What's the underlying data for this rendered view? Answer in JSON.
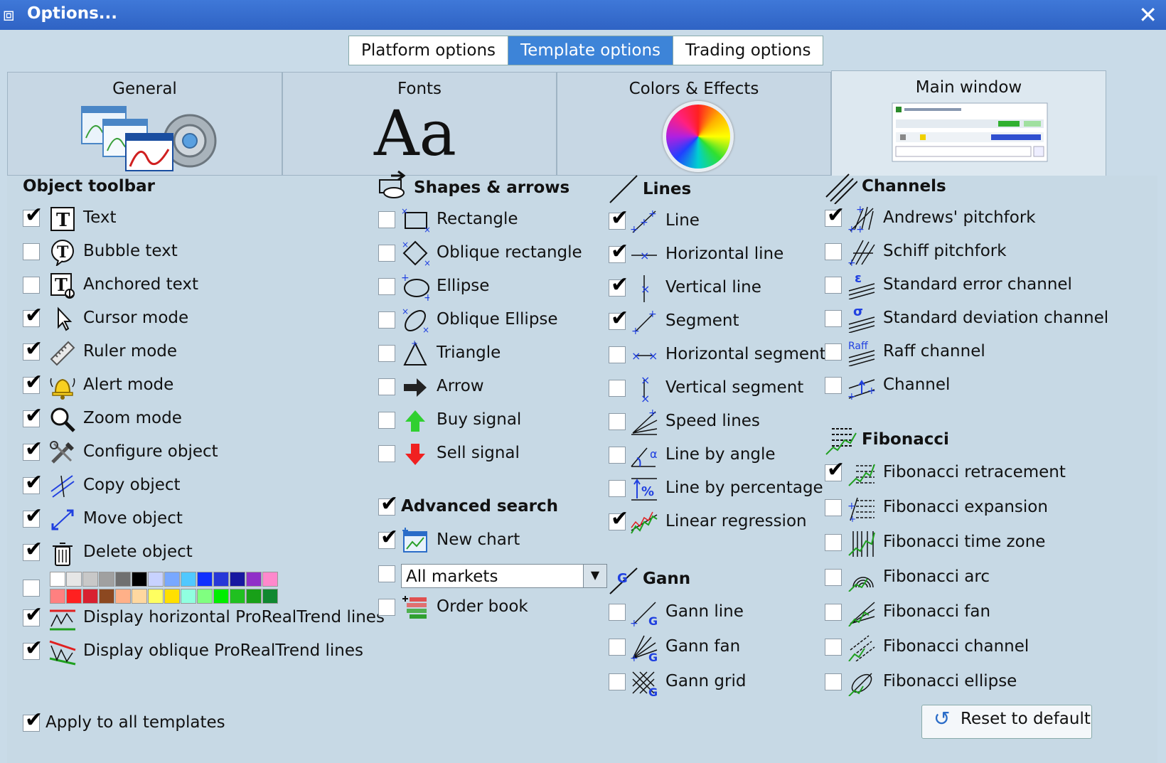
{
  "window": {
    "title": "Options..."
  },
  "top_tabs": [
    "Platform options",
    "Template options",
    "Trading options"
  ],
  "sub_tabs": [
    "General",
    "Fonts",
    "Colors & Effects",
    "Main window"
  ],
  "fonts_preview": "Aa",
  "object_toolbar": {
    "heading": "Object toolbar",
    "items": [
      {
        "label": "Text",
        "checked": true,
        "icon": "text-tool-icon"
      },
      {
        "label": "Bubble text",
        "checked": false,
        "icon": "bubble-text-icon"
      },
      {
        "label": "Anchored text",
        "checked": false,
        "icon": "anchored-text-icon"
      },
      {
        "label": "Cursor mode",
        "checked": true,
        "icon": "cursor-icon"
      },
      {
        "label": "Ruler mode",
        "checked": true,
        "icon": "ruler-icon"
      },
      {
        "label": "Alert mode",
        "checked": true,
        "icon": "bell-icon"
      },
      {
        "label": "Zoom mode",
        "checked": true,
        "icon": "magnifier-icon"
      },
      {
        "label": "Configure object",
        "checked": true,
        "icon": "tools-icon"
      },
      {
        "label": "Copy object",
        "checked": true,
        "icon": "copy-object-icon"
      },
      {
        "label": "Move object",
        "checked": true,
        "icon": "move-object-icon"
      },
      {
        "label": "Delete object",
        "checked": true,
        "icon": "trash-icon"
      }
    ],
    "palette_checked": false,
    "palette_row1": [
      "#ffffff",
      "#e6e6e6",
      "#c8c8c8",
      "#a0a0a0",
      "#707070",
      "#000000",
      "#c8d2ff",
      "#78a8ff",
      "#50c8ff",
      "#1030ff",
      "#2838d8",
      "#1818a0",
      "#9030c8",
      "#ff88cc"
    ],
    "palette_row2": [
      "#ff8080",
      "#ff2020",
      "#d82030",
      "#8c4820",
      "#ffb088",
      "#ffd8a0",
      "#ffff60",
      "#ffe000",
      "#90ffe0",
      "#80ff80",
      "#00ee00",
      "#20c020",
      "#18a018",
      "#108830"
    ],
    "extra_items": [
      {
        "label": "Display horizontal ProRealTrend lines",
        "checked": true,
        "icon": "prorealtrend-horizontal-icon"
      },
      {
        "label": "Display oblique ProRealTrend lines",
        "checked": true,
        "icon": "prorealtrend-oblique-icon"
      }
    ]
  },
  "shapes": {
    "heading": "Shapes & arrows",
    "items": [
      {
        "label": "Rectangle",
        "checked": false,
        "icon": "rectangle-icon"
      },
      {
        "label": "Oblique rectangle",
        "checked": false,
        "icon": "oblique-rectangle-icon"
      },
      {
        "label": "Ellipse",
        "checked": false,
        "icon": "ellipse-icon"
      },
      {
        "label": "Oblique Ellipse",
        "checked": false,
        "icon": "oblique-ellipse-icon"
      },
      {
        "label": "Triangle",
        "checked": false,
        "icon": "triangle-icon"
      },
      {
        "label": "Arrow",
        "checked": false,
        "icon": "arrow-icon"
      },
      {
        "label": "Buy signal",
        "checked": false,
        "icon": "buy-signal-icon"
      },
      {
        "label": "Sell signal",
        "checked": false,
        "icon": "sell-signal-icon"
      }
    ]
  },
  "advanced_search": {
    "heading": "Advanced search",
    "heading_checked": true,
    "new_chart": {
      "label": "New chart",
      "checked": true
    },
    "market_select": {
      "value": "All markets",
      "checked": false
    },
    "order_book": {
      "label": "Order book",
      "checked": false
    }
  },
  "lines": {
    "heading": "Lines",
    "items": [
      {
        "label": "Line",
        "checked": true,
        "icon": "line-tool-icon"
      },
      {
        "label": "Horizontal line",
        "checked": true,
        "icon": "horizontal-line-icon"
      },
      {
        "label": "Vertical line",
        "checked": true,
        "icon": "vertical-line-icon"
      },
      {
        "label": "Segment",
        "checked": true,
        "icon": "segment-icon"
      },
      {
        "label": "Horizontal segment",
        "checked": false,
        "icon": "horizontal-segment-icon"
      },
      {
        "label": "Vertical segment",
        "checked": false,
        "icon": "vertical-segment-icon"
      },
      {
        "label": "Speed lines",
        "checked": false,
        "icon": "speed-lines-icon"
      },
      {
        "label": "Line by angle",
        "checked": false,
        "icon": "line-by-angle-icon"
      },
      {
        "label": "Line by percentage",
        "checked": false,
        "icon": "line-by-percentage-icon"
      },
      {
        "label": "Linear regression",
        "checked": true,
        "icon": "linear-regression-icon"
      }
    ]
  },
  "gann": {
    "heading": "Gann",
    "items": [
      {
        "label": "Gann line",
        "checked": false,
        "icon": "gann-line-icon"
      },
      {
        "label": "Gann fan",
        "checked": false,
        "icon": "gann-fan-icon"
      },
      {
        "label": "Gann grid",
        "checked": false,
        "icon": "gann-grid-icon"
      }
    ]
  },
  "channels": {
    "heading": "Channels",
    "items": [
      {
        "label": "Andrews' pitchfork",
        "checked": true,
        "icon": "andrews-pitchfork-icon"
      },
      {
        "label": "Schiff pitchfork",
        "checked": false,
        "icon": "schiff-pitchfork-icon"
      },
      {
        "label": "Standard error channel",
        "checked": false,
        "icon": "standard-error-channel-icon"
      },
      {
        "label": "Standard deviation channel",
        "checked": false,
        "icon": "standard-deviation-channel-icon"
      },
      {
        "label": "Raff channel",
        "checked": false,
        "icon": "raff-channel-icon"
      },
      {
        "label": "Channel",
        "checked": false,
        "icon": "channel-icon"
      }
    ],
    "glyph_epsilon": "ε",
    "glyph_sigma": "σ",
    "glyph_raff": "Raff"
  },
  "fibonacci": {
    "heading": "Fibonacci",
    "items": [
      {
        "label": "Fibonacci retracement",
        "checked": true,
        "icon": "fibonacci-retracement-icon"
      },
      {
        "label": "Fibonacci expansion",
        "checked": false,
        "icon": "fibonacci-expansion-icon"
      },
      {
        "label": "Fibonacci time zone",
        "checked": false,
        "icon": "fibonacci-time-zone-icon"
      },
      {
        "label": "Fibonacci arc",
        "checked": false,
        "icon": "fibonacci-arc-icon"
      },
      {
        "label": "Fibonacci fan",
        "checked": false,
        "icon": "fibonacci-fan-icon"
      },
      {
        "label": "Fibonacci channel",
        "checked": false,
        "icon": "fibonacci-channel-icon"
      },
      {
        "label": "Fibonacci ellipse",
        "checked": false,
        "icon": "fibonacci-ellipse-icon"
      }
    ]
  },
  "footer": {
    "apply_label": "Apply to all templates",
    "apply_checked": true,
    "reset_label": "Reset to default"
  }
}
